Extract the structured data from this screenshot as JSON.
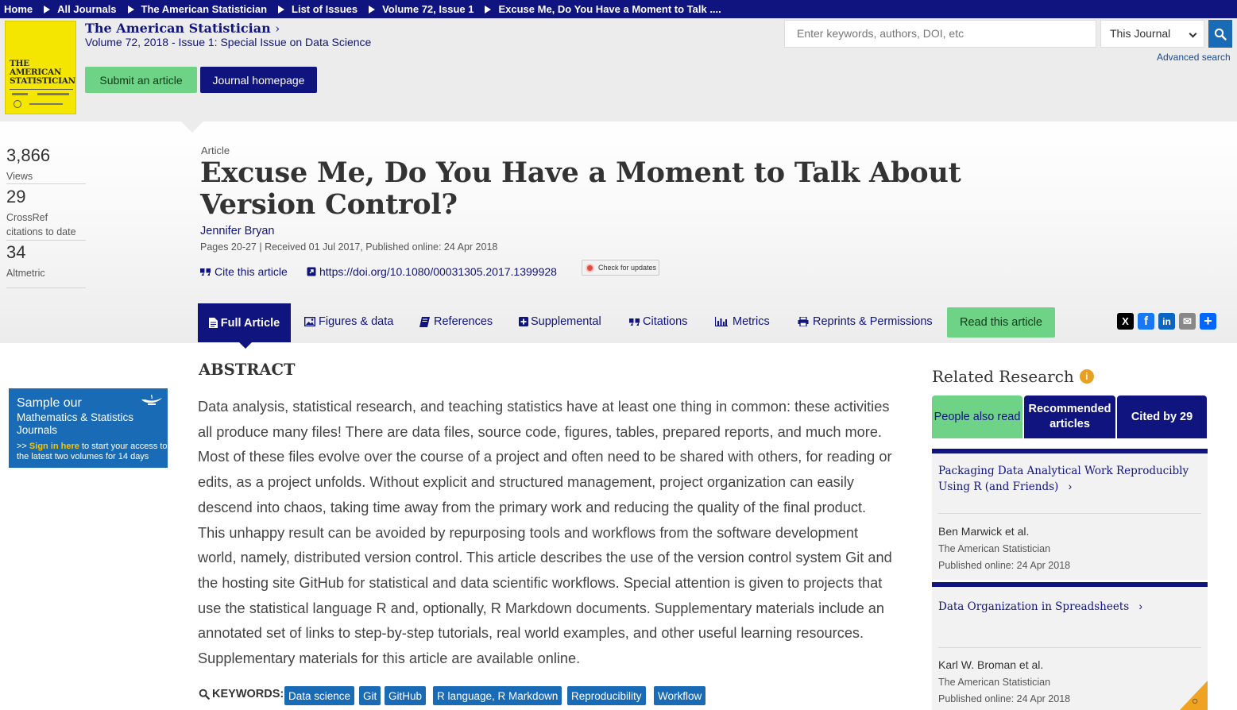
{
  "breadcrumb": {
    "items": [
      "Home",
      "All Journals",
      "The American Statistician",
      "List of Issues",
      "Volume 72, Issue 1",
      "Excuse Me, Do You Have a Moment to Talk ...."
    ]
  },
  "journal": {
    "cover_text": "THE AMERICAN STATISTICIAN",
    "title": "The American Statistician",
    "volume_line": "Volume 72, 2018 - Issue 1: Special Issue on Data Science",
    "submit_label": "Submit an article",
    "homepage_label": "Journal homepage"
  },
  "search": {
    "placeholder": "Enter keywords, authors, DOI, etc",
    "scope_selected": "This Journal",
    "advanced_label": "Advanced search"
  },
  "metrics": {
    "views": "3,866",
    "views_label": "Views",
    "crossref": "29",
    "crossref_label_1": "CrossRef",
    "crossref_label_2": "citations to date",
    "altmetric": "34",
    "altmetric_label": "Altmetric"
  },
  "article": {
    "kind": "Article",
    "title": "Excuse Me, Do You Have a Moment to Talk About Version Control?",
    "author": "Jennifer Bryan",
    "pub_info": "Pages 20-27 | Received 01 Jul 2017, Published online: 24 Apr 2018",
    "cite_label": "Cite this article",
    "doi": "https://doi.org/10.1080/00031305.2017.1399928",
    "check_updates": "Check for updates"
  },
  "tabs": {
    "full": "Full Article",
    "figures": "Figures & data",
    "references": "References",
    "supplemental": "Supplemental",
    "citations": "Citations",
    "metrics": "Metrics",
    "reprints": "Reprints & Permissions",
    "read": "Read this article"
  },
  "share": {
    "x": "X",
    "facebook": "f",
    "linkedin": "in",
    "email": "✉",
    "more": "+"
  },
  "promo": {
    "line1": "Sample our",
    "line2": "Mathematics & Statistics Journals",
    "arrow": ">>",
    "signin": "Sign in here",
    "rest": "to start your access to the latest two volumes for 14 days"
  },
  "abstract": {
    "heading": "ABSTRACT",
    "text": "Data analysis, statistical research, and teaching statistics have at least one thing in common: these activities all produce many files! There are data files, source code, figures, tables, prepared reports, and much more. Most of these files evolve over the course of a project and often need to be shared with others, for reading or edits, as a project unfolds. Without explicit and structured management, project organization can easily descend into chaos, taking time away from the primary work and reducing the quality of the final product. This unhappy result can be avoided by repurposing tools and workflows from the software development world, namely, distributed version control. This article describes the use of the version control system Git and the hosting site GitHub for statistical and data scientific workflows. Special attention is given to projects that use the statistical language R and, optionally, R Markdown documents. Supplementary materials include an annotated set of links to step-by-step tutorials, real world examples, and other useful learning resources. Supplementary materials for this article are available online."
  },
  "keywords": {
    "label": "KEYWORDS:",
    "items": [
      "Data science",
      "Git",
      "GitHub",
      "R language, R Markdown",
      "Reproducibility",
      "Workflow"
    ]
  },
  "related": {
    "heading": "Related Research",
    "tab_people": "People also read",
    "tab_recommended": "Recommended articles",
    "tab_cited": "Cited by 29",
    "cards": [
      {
        "title": "Packaging Data Analytical Work Reproducibly Using R (and Friends)",
        "authors": "Ben Marwick et al.",
        "journal": "The American Statistician",
        "published": "Published online: 24 Apr 2018"
      },
      {
        "title": "Data Organization in Spreadsheets",
        "authors": "Karl W. Broman et al.",
        "journal": "The American Statistician",
        "published": "Published online: 24 Apr 2018"
      }
    ]
  },
  "colors": {
    "navy": "#10147e",
    "green": "#6ed386",
    "blue": "#1a6bb5",
    "orange": "#f0a320"
  }
}
